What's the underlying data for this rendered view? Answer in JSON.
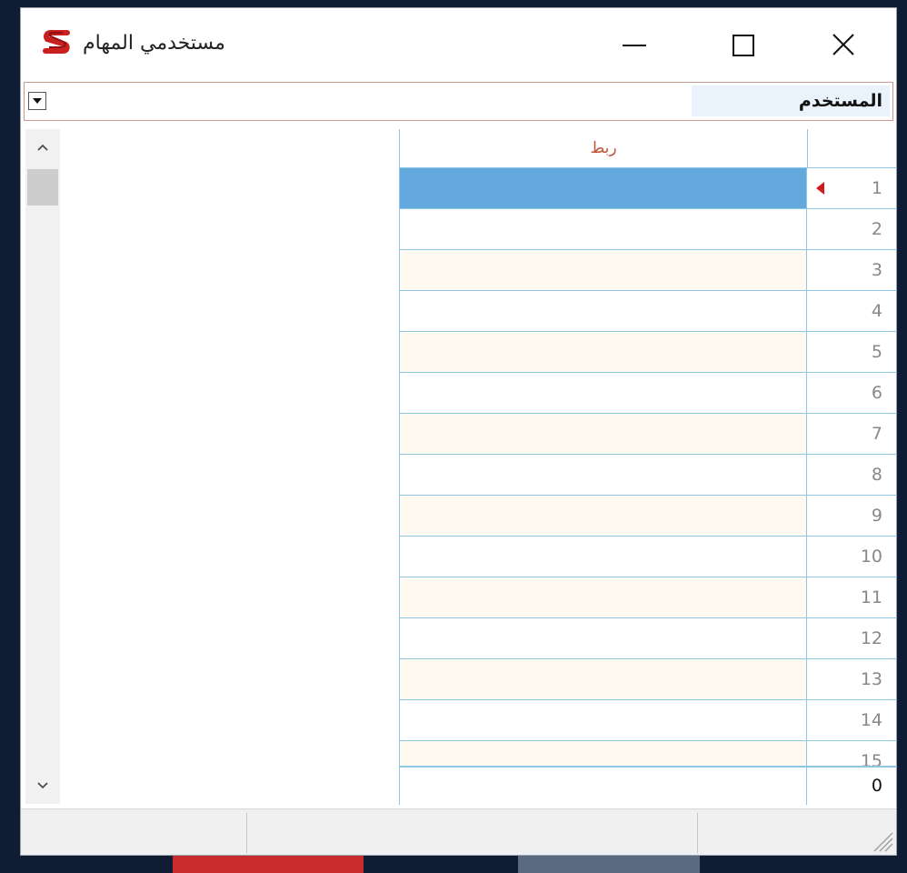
{
  "window": {
    "title": "مستخدمي المهام",
    "logo_icon": "brand-s-logo-icon",
    "controls": {
      "minimize_icon": "minimize-icon",
      "maximize_icon": "maximize-icon",
      "close_icon": "close-icon"
    }
  },
  "user_field": {
    "label": "المستخدم",
    "value": "",
    "dropdown_icon": "chevron-down-icon"
  },
  "grid": {
    "column_link_header": "ربط",
    "selected_row": 1,
    "rows": [
      "1",
      "2",
      "3",
      "4",
      "5",
      "6",
      "7",
      "8",
      "9",
      "10",
      "11",
      "12",
      "13",
      "14",
      "15"
    ],
    "footer_total": "0"
  },
  "colors": {
    "accent_red": "#d11919",
    "header_text": "#c0523a",
    "grid_line": "#8fc6e3",
    "selected_row": "#63a9dd",
    "alt_row": "#fff9f0",
    "label_bg": "#eaf2fb"
  },
  "statusbar": {
    "panels": [
      "",
      "",
      ""
    ]
  }
}
